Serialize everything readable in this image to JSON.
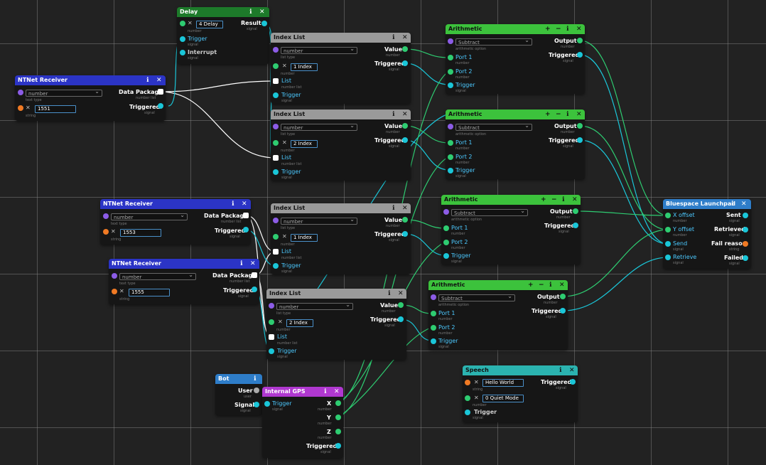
{
  "nodes": {
    "delay": {
      "title": "Delay",
      "value": "4 Delay",
      "sub_number": "number",
      "inputs": [
        "Trigger",
        "Interrupt"
      ],
      "sub_signal": "signal",
      "output": "Result"
    },
    "ntnet1": {
      "title": "NTNet Receiver",
      "type": "number",
      "type_sub": "text type",
      "freq": "1551",
      "freq_sub": "string",
      "out1": "Data Package",
      "out1_sub": "number list",
      "out2": "Triggered",
      "out2_sub": "signal"
    },
    "ntnet2": {
      "title": "NTNet Receiver",
      "type": "number",
      "type_sub": "text type",
      "freq": "1553",
      "freq_sub": "string",
      "out1": "Data Package",
      "out1_sub": "number list",
      "out2": "Triggered",
      "out2_sub": "signal"
    },
    "ntnet3": {
      "title": "NTNet Receiver",
      "type": "number",
      "type_sub": "text type",
      "freq": "1555",
      "freq_sub": "string",
      "out1": "Data Package",
      "out1_sub": "number list",
      "out2": "Triggered",
      "out2_sub": "signal"
    },
    "index1": {
      "title": "Index List",
      "type": "number",
      "type_sub": "list type",
      "index": "1 Index",
      "index_sub": "number",
      "in_list": "List",
      "in_list_sub": "number list",
      "in_trig": "Trigger",
      "in_trig_sub": "signal",
      "out1": "Value",
      "out1_sub": "number",
      "out2": "Triggered",
      "out2_sub": "signal"
    },
    "index2": {
      "title": "Index List",
      "type": "number",
      "type_sub": "list type",
      "index": "2 Index",
      "index_sub": "number",
      "in_list": "List",
      "in_list_sub": "number list",
      "in_trig": "Trigger",
      "in_trig_sub": "signal",
      "out1": "Value",
      "out1_sub": "number",
      "out2": "Triggered",
      "out2_sub": "signal"
    },
    "index3": {
      "title": "Index List",
      "type": "number",
      "type_sub": "list type",
      "index": "1 Index",
      "index_sub": "number",
      "in_list": "List",
      "in_list_sub": "number list",
      "in_trig": "Trigger",
      "in_trig_sub": "signal",
      "out1": "Value",
      "out1_sub": "number",
      "out2": "Triggered",
      "out2_sub": "signal"
    },
    "index4": {
      "title": "Index List",
      "type": "number",
      "type_sub": "list type",
      "index": "2 Index",
      "index_sub": "number",
      "in_list": "List",
      "in_list_sub": "number list",
      "in_trig": "Trigger",
      "in_trig_sub": "signal",
      "out1": "Value",
      "out1_sub": "number",
      "out2": "Triggered",
      "out2_sub": "signal"
    },
    "arith1": {
      "title": "Arithmetic",
      "op": "Subtract",
      "op_sub": "arithmetic option",
      "in1": "Port 1",
      "in2": "Port 2",
      "in_sub": "number",
      "trig": "Trigger",
      "trig_sub": "signal",
      "out1": "Output",
      "out1_sub": "number",
      "out2": "Triggered",
      "out2_sub": "signal"
    },
    "arith2": {
      "title": "Arithmetic",
      "op": "Subtract",
      "op_sub": "arithmetic option",
      "in1": "Port 1",
      "in2": "Port 2",
      "in_sub": "number",
      "trig": "Trigger",
      "trig_sub": "signal",
      "out1": "Output",
      "out1_sub": "number",
      "out2": "Triggered",
      "out2_sub": "signal"
    },
    "arith3": {
      "title": "Arithmetic",
      "op": "Subtract",
      "op_sub": "arithmetic option",
      "in1": "Port 1",
      "in2": "Port 2",
      "in_sub": "number",
      "trig": "Trigger",
      "trig_sub": "signal",
      "out1": "Output",
      "out1_sub": "number",
      "out2": "Triggered",
      "out2_sub": "signal"
    },
    "arith4": {
      "title": "Arithmetic",
      "op": "Subtract",
      "op_sub": "arithmetic option",
      "in1": "Port 1",
      "in2": "Port 2",
      "in_sub": "number",
      "trig": "Trigger",
      "trig_sub": "signal",
      "out1": "Output",
      "out1_sub": "number",
      "out2": "Triggered",
      "out2_sub": "signal"
    },
    "launchpad": {
      "title": "Bluespace Launchpad",
      "in1": "X offset",
      "in2": "Y offset",
      "in3": "Send",
      "in4": "Retrieve",
      "in_sub": "number",
      "sig_sub": "signal",
      "out1": "Sent",
      "out2": "Retrieved",
      "out3": "Fail reason",
      "out4": "Failed",
      "out3_sub": "string"
    },
    "bot": {
      "title": "Bot",
      "out1": "User",
      "out1_sub": "user",
      "out2": "Signal",
      "out2_sub": "signal"
    },
    "gps": {
      "title": "Internal GPS",
      "in1": "Trigger",
      "in1_sub": "signal",
      "out1": "X",
      "out2": "Y",
      "out3": "Z",
      "out_sub": "number",
      "out4": "Triggered",
      "out4_sub": "signal"
    },
    "speech": {
      "title": "Speech",
      "msg": "Hello World",
      "msg_sub": "string",
      "quiet": "0 Quiet Mode",
      "quiet_sub": "number",
      "trig": "Trigger",
      "trig_sub": "signal",
      "out1": "Triggered",
      "out1_sub": "signal"
    }
  },
  "colors": {
    "signal": "#1ac6d8",
    "list": "#ffffff",
    "type": "#8c5ce6",
    "string": "#f07a24",
    "number": "#2ecc71"
  }
}
